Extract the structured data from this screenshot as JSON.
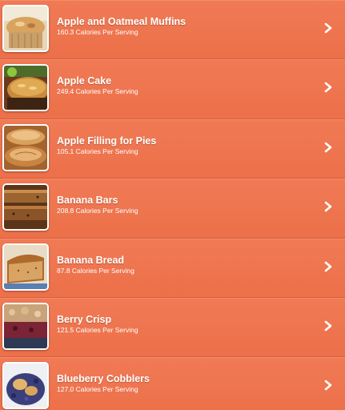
{
  "recipes": [
    {
      "title": "Apple and Oatmeal Muffins",
      "calories": "160.3 Calories Per Serving",
      "thumb_icon": "muffin-photo"
    },
    {
      "title": "Apple Cake",
      "calories": "249.4 Calories Per Serving",
      "thumb_icon": "cake-photo"
    },
    {
      "title": "Apple Filling for Pies",
      "calories": "105.1 Calories Per Serving",
      "thumb_icon": "pie-photo"
    },
    {
      "title": "Banana Bars",
      "calories": "208.8 Calories Per Serving",
      "thumb_icon": "bars-photo"
    },
    {
      "title": "Banana Bread",
      "calories": "87.8 Calories Per Serving",
      "thumb_icon": "bread-photo"
    },
    {
      "title": "Berry Crisp",
      "calories": "121.5 Calories Per Serving",
      "thumb_icon": "crisp-photo"
    },
    {
      "title": "Blueberry Cobblers",
      "calories": "127.0 Calories Per Serving",
      "thumb_icon": "cobbler-photo"
    }
  ],
  "colors": {
    "background": "#ee744f",
    "text": "#ffffff"
  }
}
